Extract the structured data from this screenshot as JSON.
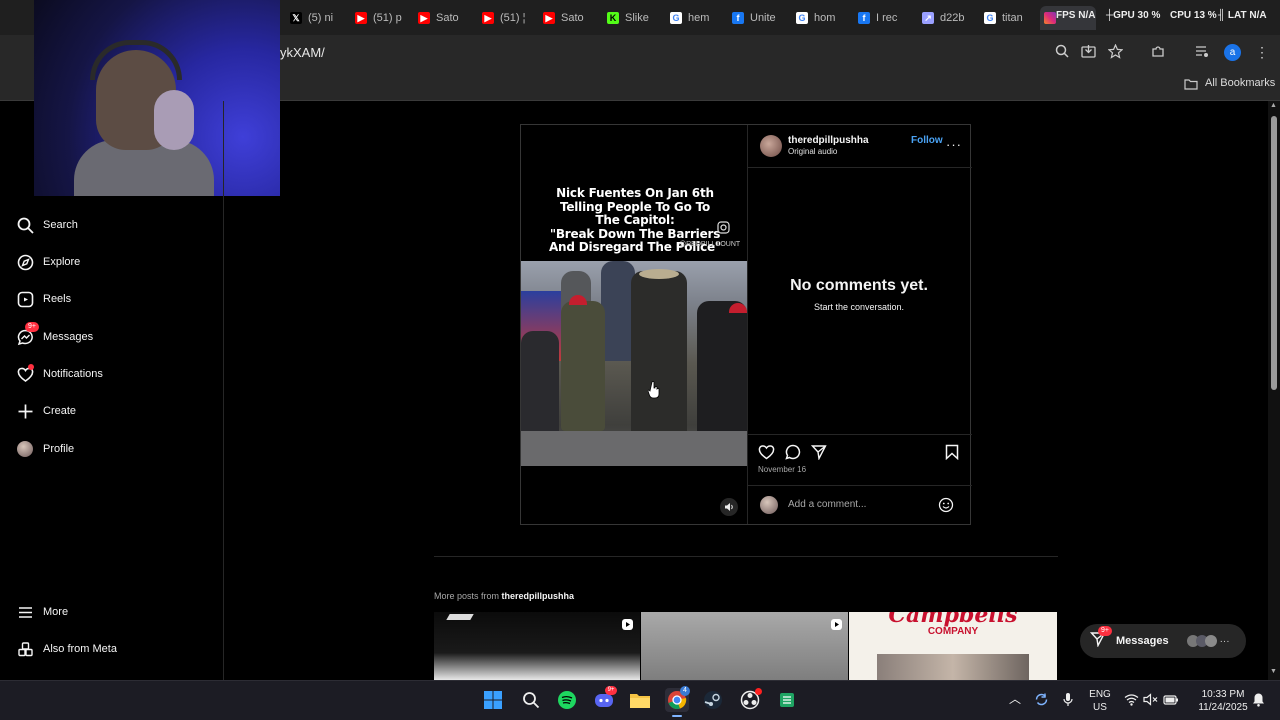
{
  "browser": {
    "tabs": [
      {
        "label": "(5) ni",
        "icon": "x-logo-icon",
        "color": "#000000"
      },
      {
        "label": "(51) p",
        "icon": "youtube-icon",
        "color": "#ff0000"
      },
      {
        "label": "Sato",
        "icon": "youtube-icon",
        "color": "#ff0000"
      },
      {
        "label": "(51) ¦",
        "icon": "youtube-icon",
        "color": "#ff0000"
      },
      {
        "label": "Sato",
        "icon": "youtube-icon",
        "color": "#ff0000"
      },
      {
        "label": "Slike",
        "icon": "kick-icon",
        "color": "#53fc18"
      },
      {
        "label": "hem",
        "icon": "google-icon",
        "color": "#ffffff"
      },
      {
        "label": "Unite",
        "icon": "facebook-icon",
        "color": "#1877f2"
      },
      {
        "label": "hom",
        "icon": "google-icon",
        "color": "#ffffff"
      },
      {
        "label": "I rec",
        "icon": "facebook-icon",
        "color": "#1877f2"
      },
      {
        "label": "d22b",
        "icon": "arrow-icon",
        "color": "#9aa0ff"
      },
      {
        "label": "titan",
        "icon": "google-icon",
        "color": "#ffffff"
      }
    ],
    "perf": {
      "fps_label": "FPS",
      "fps_value": "N/A",
      "gpu_label": "GPU",
      "gpu_value": "30 %",
      "cpu_label": "CPU",
      "cpu_value": "13 %",
      "lat_label": "LAT",
      "lat_value": "N/A"
    },
    "url": "ykXAM/",
    "bookmarks_label": "All Bookmarks",
    "avatar_letter": "a"
  },
  "sidebar": {
    "items": [
      {
        "label": "Search",
        "icon": "search-icon"
      },
      {
        "label": "Explore",
        "icon": "compass-icon"
      },
      {
        "label": "Reels",
        "icon": "reels-icon"
      },
      {
        "label": "Messages",
        "icon": "messenger-icon",
        "badge": "9+"
      },
      {
        "label": "Notifications",
        "icon": "heart-icon"
      },
      {
        "label": "Create",
        "icon": "plus-icon"
      },
      {
        "label": "Profile",
        "icon": "profile-avatar"
      }
    ],
    "bottom": [
      {
        "label": "More",
        "icon": "menu-icon"
      },
      {
        "label": "Also from Meta",
        "icon": "meta-apps-icon"
      }
    ]
  },
  "post": {
    "caption": "Nick Fuentes On Jan 6th\nTelling People To Go To\nThe Capitol:\n\"Break Down The Barriers\nAnd Disregard The Police\"",
    "watermark": "@REDPILLCOUNT",
    "username": "theredpillpushha",
    "follow_label": "Follow",
    "audio": "Original audio",
    "no_comments_title": "No comments yet.",
    "no_comments_sub": "Start the conversation.",
    "date": "November 16",
    "comment_placeholder": "Add a comment..."
  },
  "more_posts": {
    "prefix": "More posts from",
    "username": "theredpillpushha",
    "thumb3_text": "Campbells",
    "thumb3_sub": "COMPANY"
  },
  "messages_pill": {
    "label": "Messages",
    "badge": "9+"
  },
  "taskbar": {
    "lang_top": "ENG",
    "lang_bottom": "US",
    "time": "10:33 PM",
    "date": "11/24/2025",
    "chrome_badge": "4"
  }
}
